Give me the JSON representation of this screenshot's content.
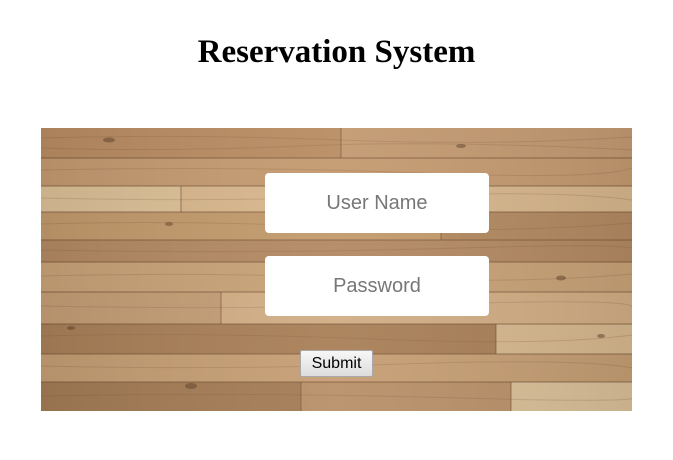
{
  "header": {
    "title": "Reservation System"
  },
  "form": {
    "username_placeholder": "User Name",
    "password_placeholder": "Password",
    "submit_label": "Submit"
  },
  "theme": {
    "panel_background": "wood-planks",
    "title_color": "#000000",
    "field_background": "#ffffff"
  }
}
